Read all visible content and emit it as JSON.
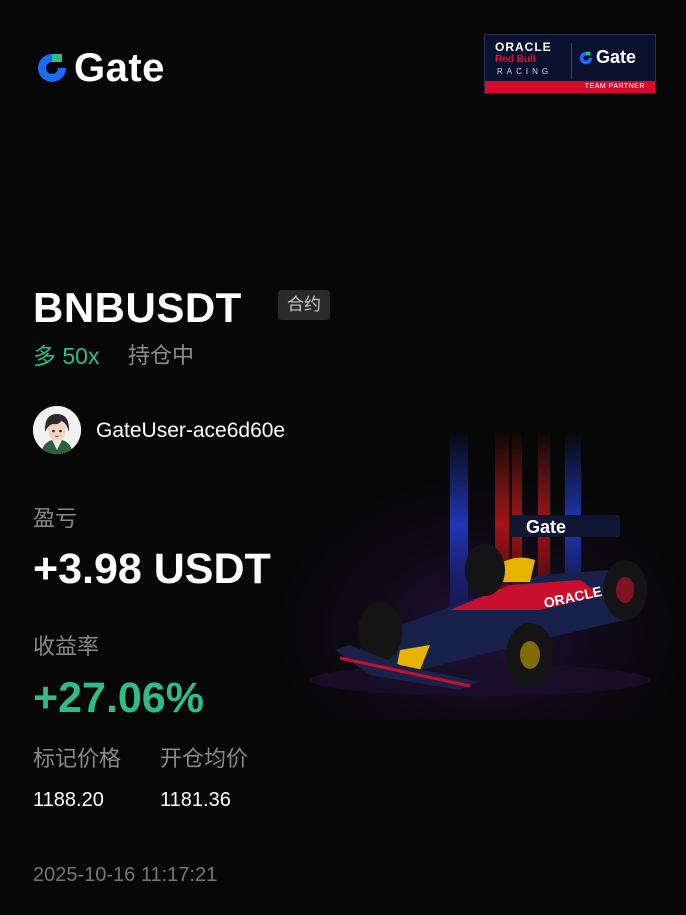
{
  "brand": {
    "name": "Gate",
    "accent": "#1c6bff",
    "accent_green": "#2ebd85"
  },
  "partner_badge": {
    "oracle": "ORACLE",
    "redbull": "Red Bull",
    "racing": "RACING",
    "gate": "Gate",
    "caption": "TEAM PARTNER"
  },
  "position": {
    "symbol": "BNBUSDT",
    "type_tag": "合约",
    "direction": "多 50x",
    "status": "持仓中"
  },
  "user": {
    "name": "GateUser-ace6d60e",
    "avatar_icon": "user-avatar"
  },
  "stats": {
    "pnl_label": "盈亏",
    "pnl_value": "+3.98 USDT",
    "roi_label": "收益率",
    "roi_value": "+27.06%",
    "mark_price_label": "标记价格",
    "mark_price_value": "1188.20",
    "entry_price_label": "开仓均价",
    "entry_price_value": "1181.36"
  },
  "timestamp": "2025-10-16 11:17:21",
  "colors": {
    "positive": "#2ebd85",
    "muted": "#8a8a8a",
    "background": "#070707"
  }
}
